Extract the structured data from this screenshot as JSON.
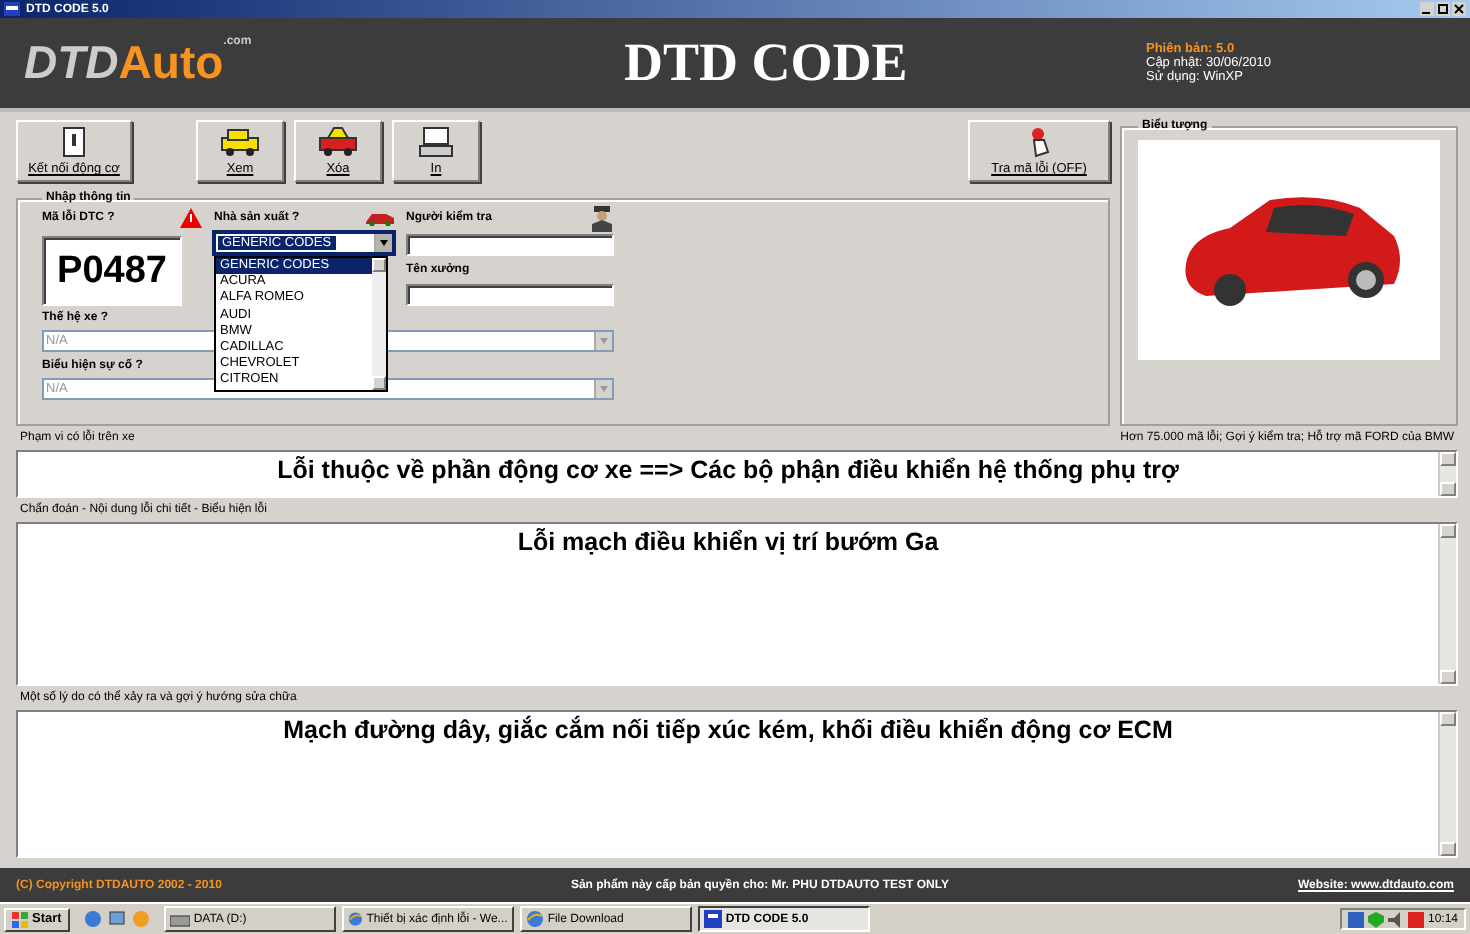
{
  "window": {
    "title": "DTD CODE 5.0"
  },
  "header": {
    "logo_main": "DTD",
    "logo_accent": "Auto",
    "logo_suffix": ".com",
    "title": "DTD CODE",
    "version": "Phiên bản: 5.0",
    "updated": "Cập nhật: 30/06/2010",
    "platform": "Sử dụng: WinXP"
  },
  "toolbar": [
    {
      "kind": "plug",
      "label": "Kết nối động cơ"
    },
    {
      "kind": "view",
      "label": "Xem"
    },
    {
      "kind": "erase",
      "label": "Xóa"
    },
    {
      "kind": "print",
      "label": "In"
    }
  ],
  "lookup_button": {
    "label": "Tra mã lỗi (OFF)"
  },
  "input_group": {
    "legend": "Nhập thông tin",
    "dtc_label": "Mã lỗi DTC ?",
    "dtc_code": "P0487",
    "manufacturer_label": "Nhà sản xuất ?",
    "inspector_label": "Người kiểm tra",
    "workshop_label": "Tên xưởng",
    "generation_label": "Thế hệ xe ?",
    "symptom_label": "Biểu hiện sự cố ?"
  },
  "manufacturer": {
    "value": "GENERIC CODES",
    "expanded": true,
    "options": [
      {
        "label": "GENERIC CODES",
        "selected": true
      },
      {
        "label": "ACURA",
        "selected": false
      },
      {
        "label": "ALFA ROMEO",
        "selected": false
      },
      {
        "label": "AUDI",
        "selected": false
      },
      {
        "label": "BMW",
        "selected": false
      },
      {
        "label": "CADILLAC",
        "selected": false
      },
      {
        "label": "CHEVROLET",
        "selected": false
      },
      {
        "label": "CITROEN",
        "selected": false
      }
    ]
  },
  "generation": {
    "value": "N/A",
    "disabled": true
  },
  "symptom": {
    "value": "N/A",
    "disabled": true
  },
  "image_panel": {
    "legend": "Biểu tượng"
  },
  "scope": {
    "label": "Phạm vi có lỗi trên xe",
    "note": "Hơn 75.000 mã lỗi; Gợi ý kiểm tra; Hỗ trợ mã FORD của BMW",
    "text": "Lỗi thuộc về phần động cơ xe ==>  Các bộ phận điều khiển hệ thống phụ trợ"
  },
  "diagnosis": {
    "label": "Chẩn đoán - Nội dung lỗi chi tiết - Biểu hiện lỗi",
    "text": "Lỗi mạch điều khiển vị trí bướm Ga"
  },
  "causes": {
    "label": "Một số lý do có thể xảy ra và gợi ý hướng sửa chữa",
    "text": "Mạch đường dây, giắc cắm nối tiếp xúc kém, khối điều khiển động cơ ECM"
  },
  "footer": {
    "copyright": "(C) Copyright DTDAUTO 2002 - 2010",
    "license": "Sản phẩm này cấp bản quyền cho: Mr. PHU DTDAUTO TEST ONLY",
    "website": "Website: www.dtdauto.com"
  },
  "taskbar": {
    "start": "Start",
    "tasks": [
      {
        "kind": "drive",
        "label": "DATA (D:)",
        "selected": false
      },
      {
        "kind": "browser",
        "label": "Thiết bị xác định lỗi - We...",
        "selected": false
      },
      {
        "kind": "browser",
        "label": "File Download",
        "selected": false
      },
      {
        "kind": "app",
        "label": "DTD CODE 5.0",
        "selected": true
      }
    ],
    "clock": "10:14"
  }
}
